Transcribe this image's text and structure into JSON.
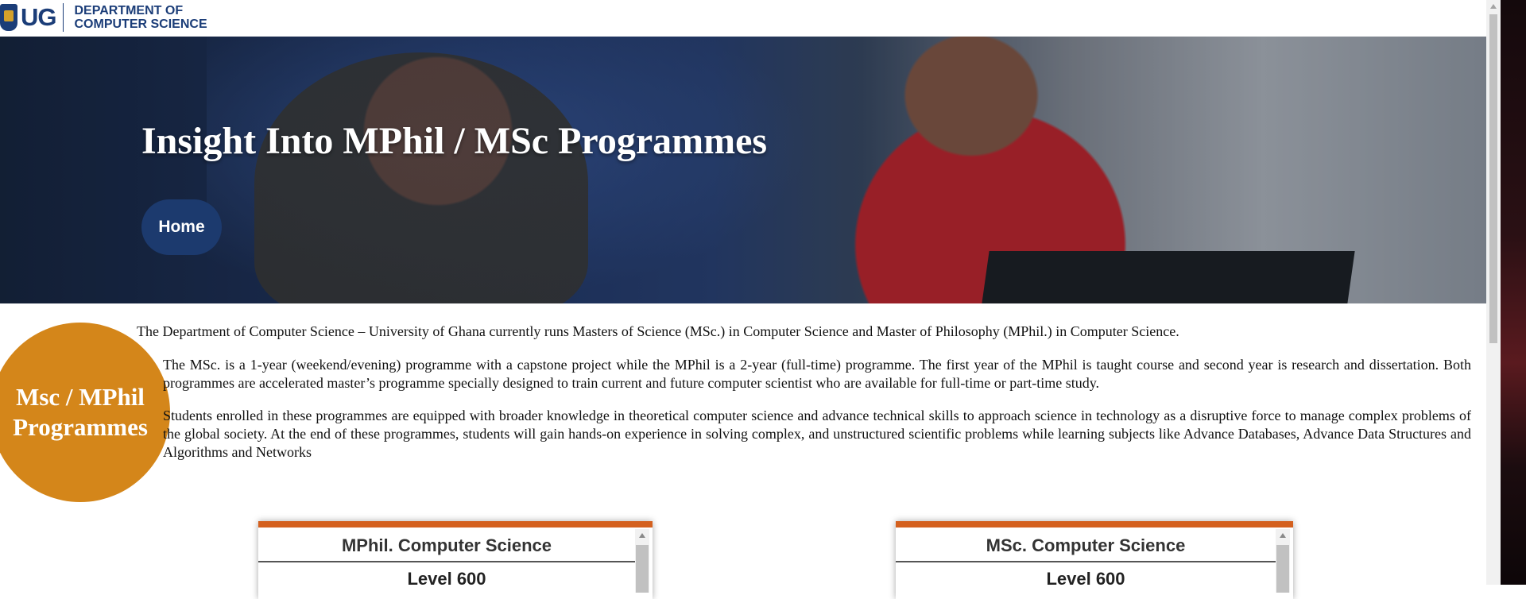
{
  "header": {
    "logo_mark": "UG",
    "department_line1": "DEPARTMENT OF",
    "department_line2": "COMPUTER SCIENCE"
  },
  "hero": {
    "title": "Insight Into MPhil / MSc Programmes",
    "home_label": "Home"
  },
  "intro": {
    "badge_line1": "Msc / MPhil",
    "badge_line2": "Programmes",
    "paragraph1": "The Department of Computer Science – University of Ghana currently runs Masters of Science (MSc.) in Computer Science and Master of Philosophy (MPhil.) in Computer Science.",
    "paragraph2": "The MSc. is a 1-year (weekend/evening) programme with a capstone project while the MPhil is a 2-year (full-time) programme. The first year of the MPhil is taught course and second year is research and dissertation. Both programmes are accelerated master’s programme specially designed to train current and future computer scientist who are available for full-time or part-time study.",
    "paragraph3": "Students enrolled in these programmes are equipped with broader knowledge in theoretical computer science and advance technical skills to approach science in technology as a disruptive force to manage complex problems of the global society. At the end of these programmes, students will gain hands-on experience in solving complex, and unstructured scientific problems while learning subjects like Advance Databases, Advance Data Structures and Algorithms and Networks"
  },
  "cards": [
    {
      "title": "MPhil. Computer Science",
      "level": "Level 600"
    },
    {
      "title": "MSc. Computer Science",
      "level": "Level 600"
    }
  ],
  "colors": {
    "brand_blue": "#1b3d78",
    "badge_orange": "#d4861a",
    "card_accent": "#d4601e"
  }
}
